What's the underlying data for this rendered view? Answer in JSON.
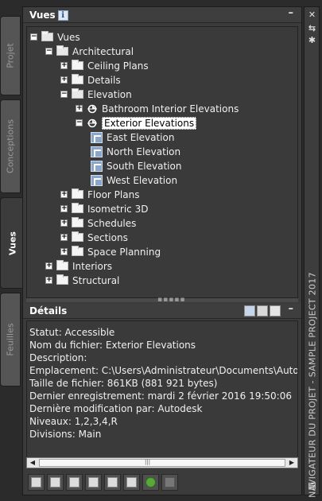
{
  "side_tabs": [
    {
      "label": "Projet",
      "active": false
    },
    {
      "label": "Conceptions",
      "active": false
    },
    {
      "label": "Vues",
      "active": true
    },
    {
      "label": "Feuilles",
      "active": false
    }
  ],
  "views_panel": {
    "title": "Vues",
    "info_glyph": "i",
    "collapse_glyph": "–"
  },
  "tree": [
    {
      "label": "Vues",
      "expander": "−",
      "icon": "folder-open-icon",
      "level": 0
    },
    {
      "label": "Architectural",
      "expander": "−",
      "icon": "folder-open-icon",
      "level": 1
    },
    {
      "label": "Ceiling Plans",
      "expander": "+",
      "icon": "folder-icon",
      "level": 2
    },
    {
      "label": "Details",
      "expander": "+",
      "icon": "folder-icon",
      "level": 2
    },
    {
      "label": "Elevation",
      "expander": "−",
      "icon": "folder-open-icon",
      "level": 2
    },
    {
      "label": "Bathroom Interior Elevations",
      "expander": "+",
      "icon": "view-icon",
      "level": 3
    },
    {
      "label": "Exterior Elevations",
      "expander": "−",
      "icon": "view-icon",
      "level": 3,
      "selected": true
    },
    {
      "label": "East Elevation",
      "expander": "",
      "icon": "sheet-view-icon",
      "level": 4
    },
    {
      "label": "North Elevation",
      "expander": "",
      "icon": "sheet-view-icon",
      "level": 4
    },
    {
      "label": "South Elevation",
      "expander": "",
      "icon": "sheet-view-icon",
      "level": 4
    },
    {
      "label": "West Elevation",
      "expander": "",
      "icon": "sheet-view-icon",
      "level": 4
    },
    {
      "label": "Floor Plans",
      "expander": "+",
      "icon": "folder-icon",
      "level": 2
    },
    {
      "label": "Isometric 3D",
      "expander": "+",
      "icon": "folder-icon",
      "level": 2
    },
    {
      "label": "Schedules",
      "expander": "+",
      "icon": "folder-icon",
      "level": 2
    },
    {
      "label": "Sections",
      "expander": "+",
      "icon": "folder-icon",
      "level": 2
    },
    {
      "label": "Space Planning",
      "expander": "+",
      "icon": "folder-icon",
      "level": 2
    },
    {
      "label": "Interiors",
      "expander": "+",
      "icon": "folder-icon",
      "level": 1
    },
    {
      "label": "Structural",
      "expander": "+",
      "icon": "folder-icon",
      "level": 1
    }
  ],
  "details_panel": {
    "title": "Détails",
    "collapse_glyph": "–",
    "lines": [
      "Statut: Accessible",
      "Nom du fichier: Exterior Elevations",
      "Description:",
      "Emplacement: C:\\Users\\Administrateur\\Documents\\Autodesk\\",
      "Taille de fichier: 861KB (881 921 bytes)",
      "Dernier enregistrement: mardi 2 février 2016  19:50:06",
      "Dernière modification par: Autodesk",
      "Niveaux: 1,2,3,4,R",
      "Divisions: Main"
    ]
  },
  "scrollbar": {
    "left_arrow": "◀",
    "right_arrow": "▶",
    "grip": "|||"
  },
  "splitter_grip": "▪▪▪▪▪",
  "toolbar_buttons": [
    "new-view-icon",
    "new-callout-icon",
    "new-detail-icon",
    "clipboard-icon",
    "edit-view-icon",
    "properties-icon",
    "refresh-icon",
    "disabled-icon"
  ],
  "right_rail": {
    "title": "NAVIGATEUR DU PROJET - SAMPLE PROJECT 2017",
    "icons": [
      {
        "name": "close-icon",
        "glyph": "✕"
      },
      {
        "name": "auto-hide-icon",
        "glyph": "⇆"
      },
      {
        "name": "settings-icon",
        "glyph": "✱"
      },
      {
        "name": "properties-menu-icon",
        "glyph": "▤"
      }
    ]
  }
}
